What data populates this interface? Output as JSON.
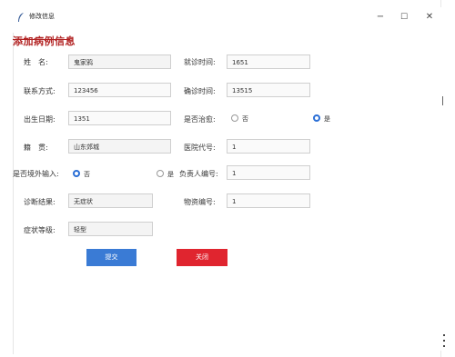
{
  "window": {
    "title": "修改信息",
    "controls": {
      "minimize": "−",
      "maximize": "☐",
      "close": "✕"
    }
  },
  "form": {
    "heading": "添加病例信息",
    "name": {
      "label": "姓　名:",
      "value": "鬼家鸦"
    },
    "contact": {
      "label": "联系方式:",
      "value": "123456"
    },
    "birth_date": {
      "label": "出生日期:",
      "value": "1351"
    },
    "origin": {
      "label": "籍　贯:",
      "value": "山东郊城"
    },
    "overseas": {
      "label": "是否境外输入:",
      "options": [
        "否",
        "是"
      ],
      "selected": "否"
    },
    "diagnosis": {
      "label": "诊断结果:",
      "value": "无症状"
    },
    "severity": {
      "label": "症状等级:",
      "value": "轻型"
    },
    "visit_time": {
      "label": "就诊时间:",
      "value": "1651"
    },
    "confirm_time": {
      "label": "确诊时间:",
      "value": "13515"
    },
    "cured": {
      "label": "是否治愈:",
      "options": [
        "否",
        "是"
      ],
      "selected": "是"
    },
    "hospital_code": {
      "label": "医院代号:",
      "value": "1"
    },
    "staff_id": {
      "label": "负责人编号:",
      "value": "1"
    },
    "supply_id": {
      "label": "物资编号:",
      "value": "1"
    }
  },
  "buttons": {
    "submit": "提交",
    "close": "关闭"
  },
  "colors": {
    "heading": "#b22222",
    "submit": "#3a7bd5",
    "close": "#e0252f",
    "radio_selected": "#2b6fd6"
  }
}
